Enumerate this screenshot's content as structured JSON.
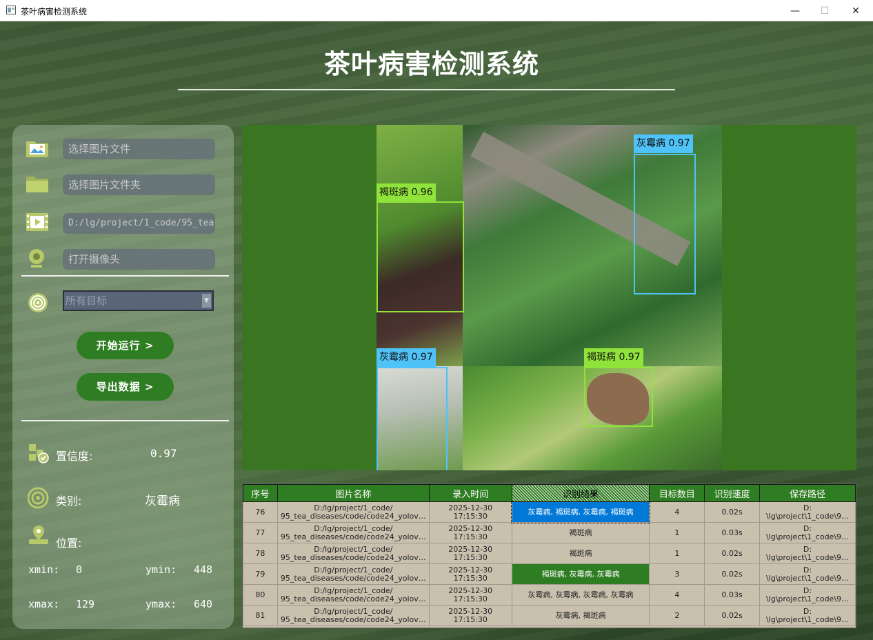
{
  "window": {
    "title": "茶叶病害检测系统",
    "controls": [
      "—",
      "☐",
      "✕"
    ]
  },
  "header": {
    "title": "茶叶病害检测系统"
  },
  "left_panel": {
    "select_image_placeholder": "选择图片文件",
    "select_folder_placeholder": "选择图片文件夹",
    "video_path": "D:/lg/project/1_code/95_tea",
    "camera_placeholder": "打开摄像头",
    "target_select": "所有目标",
    "start_button": "开始运行 >",
    "export_button": "导出数据 >",
    "confidence_label": "置信度:",
    "confidence_value": "0.97",
    "class_label": "类别:",
    "class_value": "灰霉病",
    "position_label": "位置:",
    "xmin_label": "xmin:",
    "xmin_value": "0",
    "ymin_label": "ymin:",
    "ymin_value": "448",
    "xmax_label": "xmax:",
    "xmax_value": "129",
    "ymax_label": "ymax:",
    "ymax_value": "640"
  },
  "detections": [
    {
      "label": "褐斑病 0.96",
      "color": "#8fe33a"
    },
    {
      "label": "灰霉病 0.97",
      "color": "#4fc3f7"
    },
    {
      "label": "灰霉病 0.97",
      "color": "#4fc3f7"
    },
    {
      "label": "褐斑病 0.97",
      "color": "#8fe33a"
    }
  ],
  "table": {
    "headers": [
      "序号",
      "图片名称",
      "录入时间",
      "识别结果",
      "目标数目",
      "识别速度",
      "保存路径"
    ],
    "rows": [
      {
        "id": "76",
        "name1": "D:/lg/project/1_code/",
        "name2": "95_tea_diseases/code/code24_yolov…",
        "date": "2025-12-30",
        "time": "17:15:30",
        "result": "灰霉病, 褐斑病, 灰霉病, 褐斑病",
        "count": "4",
        "speed": "0.02s",
        "path1": "D:",
        "path2": "\\lg\\project\\1_code\\9…"
      },
      {
        "id": "77",
        "name1": "D:/lg/project/1_code/",
        "name2": "95_tea_diseases/code/code24_yolov…",
        "date": "2025-12-30",
        "time": "17:15:30",
        "result": "褐斑病",
        "count": "1",
        "speed": "0.03s",
        "path1": "D:",
        "path2": "\\lg\\project\\1_code\\9…"
      },
      {
        "id": "78",
        "name1": "D:/lg/project/1_code/",
        "name2": "95_tea_diseases/code/code24_yolov…",
        "date": "2025-12-30",
        "time": "17:15:30",
        "result": "褐斑病",
        "count": "1",
        "speed": "0.02s",
        "path1": "D:",
        "path2": "\\lg\\project\\1_code\\9…"
      },
      {
        "id": "79",
        "name1": "D:/lg/project/1_code/",
        "name2": "95_tea_diseases/code/code24_yolov…",
        "date": "2025-12-30",
        "time": "17:15:30",
        "result": "褐斑病, 灰霉病, 灰霉病",
        "count": "3",
        "speed": "0.02s",
        "path1": "D:",
        "path2": "\\lg\\project\\1_code\\9…"
      },
      {
        "id": "80",
        "name1": "D:/lg/project/1_code/",
        "name2": "95_tea_diseases/code/code24_yolov…",
        "date": "2025-12-30",
        "time": "17:15:30",
        "result": "灰霉病, 灰霉病, 灰霉病, 灰霉病",
        "count": "4",
        "speed": "0.03s",
        "path1": "D:",
        "path2": "\\lg\\project\\1_code\\9…"
      },
      {
        "id": "81",
        "name1": "D:/lg/project/1_code/",
        "name2": "95_tea_diseases/code/code24_yolov…",
        "date": "2025-12-30",
        "time": "17:15:30",
        "result": "灰霉病, 褐斑病",
        "count": "2",
        "speed": "0.02s",
        "path1": "D:",
        "path2": "\\lg\\project\\1_code\\9…"
      }
    ]
  }
}
